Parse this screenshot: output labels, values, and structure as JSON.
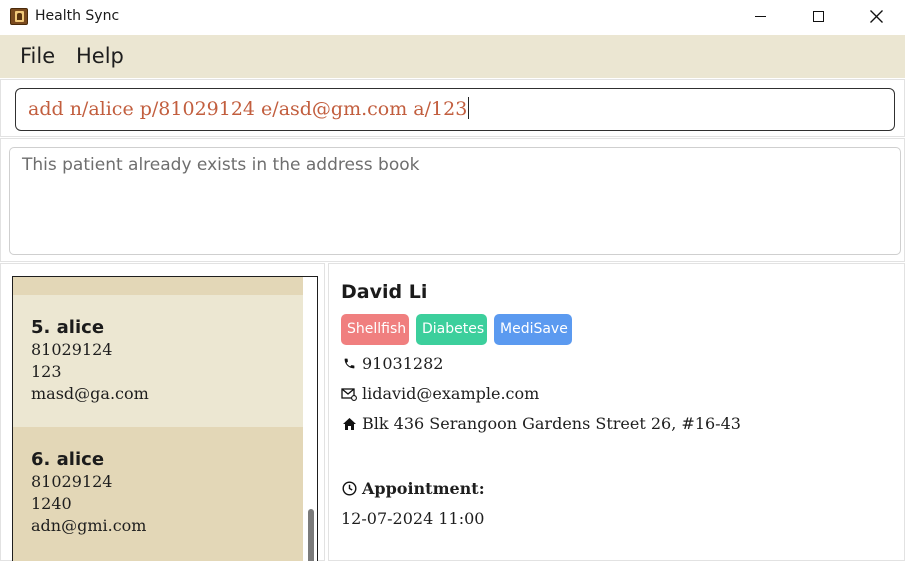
{
  "window": {
    "title": "Health Sync",
    "controls": [
      "minimize",
      "maximize",
      "close"
    ]
  },
  "menu": {
    "file_label": "File",
    "help_label": "Help"
  },
  "command": {
    "value": "add n/alice p/81029124 e/asd@gm.com a/123"
  },
  "result": {
    "message": "This patient already exists in the address book"
  },
  "patients": [
    {
      "index": "5.",
      "name": "alice",
      "phone": "81029124",
      "address": "123",
      "email": "masd@ga.com"
    },
    {
      "index": "6.",
      "name": "alice",
      "phone": "81029124",
      "address": "1240",
      "email": "adn@gmi.com"
    }
  ],
  "detail": {
    "name": "David Li",
    "tags": [
      {
        "label": "Shellfish",
        "color": "#f07f7f"
      },
      {
        "label": "Diabetes",
        "color": "#3ccf9c"
      },
      {
        "label": "MediSave",
        "color": "#5b9af0"
      }
    ],
    "phone": "91031282",
    "email": "lidavid@example.com",
    "address": "Blk 436 Serangoon Gardens Street 26, #16-43",
    "appointment_label": "Appointment:",
    "appointment_value": "12-07-2024 11:00"
  },
  "colors": {
    "menu_bg": "#ebe6d2",
    "card_even_bg": "#e3d7b7",
    "card_odd_bg": "#ece7d2",
    "command_text": "#c25e3e"
  }
}
